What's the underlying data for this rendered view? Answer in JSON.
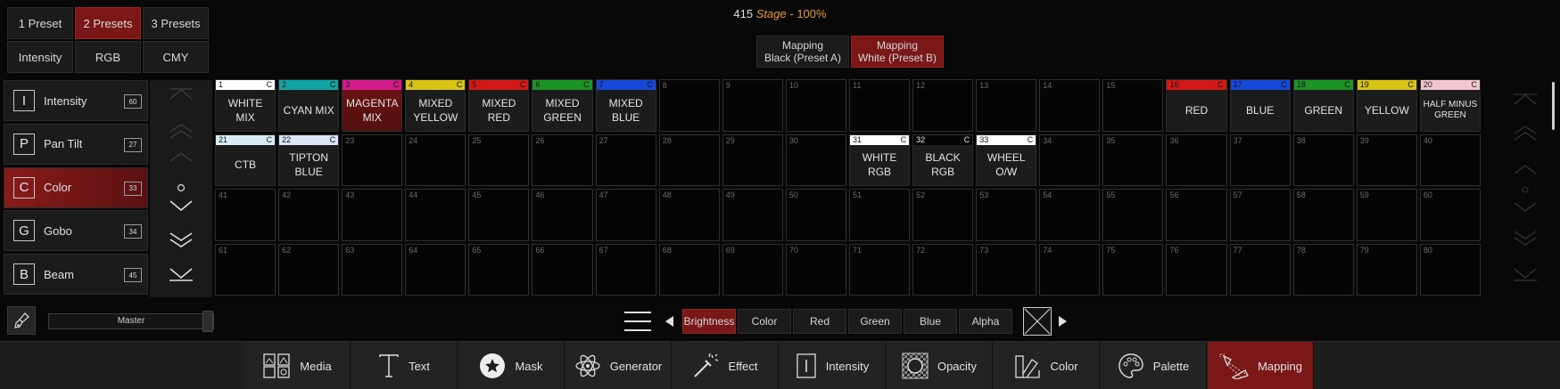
{
  "header": {
    "cue": "415",
    "stage": "Stage",
    "sep": "-",
    "percent": "100%"
  },
  "preset_tabs": [
    {
      "label": "1 Preset",
      "active": false
    },
    {
      "label": "2 Presets",
      "active": true
    },
    {
      "label": "3 Presets",
      "active": false
    },
    {
      "label": "Intensity",
      "active": false
    },
    {
      "label": "RGB",
      "active": false
    },
    {
      "label": "CMY",
      "active": false
    }
  ],
  "features": [
    {
      "letter": "I",
      "label": "Intensity",
      "count": "60",
      "active": false
    },
    {
      "letter": "P",
      "label": "Pan Tilt",
      "count": "27",
      "active": false
    },
    {
      "letter": "C",
      "label": "Color",
      "count": "33",
      "active": true
    },
    {
      "letter": "G",
      "label": "Gobo",
      "count": "34",
      "active": false
    },
    {
      "letter": "B",
      "label": "Beam",
      "count": "45",
      "active": false
    }
  ],
  "mapping_tabs": [
    {
      "line1": "Mapping",
      "line2": "Black (Preset A)",
      "active": false
    },
    {
      "line1": "Mapping",
      "line2": "White (Preset B)",
      "active": true
    }
  ],
  "palette": [
    {
      "n": "1",
      "name": "WHITE MIX",
      "color": "#ffffff",
      "c": "C"
    },
    {
      "n": "2",
      "name": "CYAN MIX",
      "color": "#12a3a3",
      "c": "C"
    },
    {
      "n": "3",
      "name": "MAGENTA MIX",
      "color": "#d21c8c",
      "c": "C",
      "sel": true
    },
    {
      "n": "4",
      "name": "MIXED YELLOW",
      "color": "#d8c414",
      "c": "C"
    },
    {
      "n": "5",
      "name": "MIXED RED",
      "color": "#d41818",
      "c": "C"
    },
    {
      "n": "6",
      "name": "MIXED GREEN",
      "color": "#1c9428",
      "c": "C"
    },
    {
      "n": "7",
      "name": "MIXED BLUE",
      "color": "#1848d8",
      "c": "C"
    },
    {
      "n": "8"
    },
    {
      "n": "9"
    },
    {
      "n": "10"
    },
    {
      "n": "11"
    },
    {
      "n": "12"
    },
    {
      "n": "13"
    },
    {
      "n": "14"
    },
    {
      "n": "15"
    },
    {
      "n": "16",
      "name": "RED",
      "color": "#d41818",
      "c": "C"
    },
    {
      "n": "17",
      "name": "BLUE",
      "color": "#1848d8",
      "c": "C"
    },
    {
      "n": "18",
      "name": "GREEN",
      "color": "#1c9428",
      "c": "C"
    },
    {
      "n": "19",
      "name": "YELLOW",
      "color": "#d8c414",
      "c": "C"
    },
    {
      "n": "20",
      "name": "HALF MINUS GREEN",
      "color": "#f2c6cc",
      "c": "C",
      "small": true
    },
    {
      "n": "21",
      "name": "CTB",
      "color": "#d8ecf4",
      "c": "C"
    },
    {
      "n": "22",
      "name": "TIPTON BLUE",
      "color": "#dde4f8",
      "c": "C"
    },
    {
      "n": "23"
    },
    {
      "n": "24"
    },
    {
      "n": "25"
    },
    {
      "n": "26"
    },
    {
      "n": "27"
    },
    {
      "n": "28"
    },
    {
      "n": "29"
    },
    {
      "n": "30"
    },
    {
      "n": "31",
      "name": "WHITE RGB",
      "color": "#ffffff",
      "c": "C"
    },
    {
      "n": "32",
      "name": "BLACK RGB",
      "color": "#050505",
      "c": "C",
      "darkbar": true
    },
    {
      "n": "33",
      "name": "WHEEL O/W",
      "color": "#ffffff",
      "c": "C"
    },
    {
      "n": "34"
    },
    {
      "n": "35"
    },
    {
      "n": "36"
    },
    {
      "n": "37"
    },
    {
      "n": "38"
    },
    {
      "n": "39"
    },
    {
      "n": "40"
    },
    {
      "n": "41"
    },
    {
      "n": "42"
    },
    {
      "n": "43"
    },
    {
      "n": "44"
    },
    {
      "n": "45"
    },
    {
      "n": "46"
    },
    {
      "n": "47"
    },
    {
      "n": "48"
    },
    {
      "n": "49"
    },
    {
      "n": "50"
    },
    {
      "n": "51"
    },
    {
      "n": "52"
    },
    {
      "n": "53"
    },
    {
      "n": "54"
    },
    {
      "n": "55"
    },
    {
      "n": "56"
    },
    {
      "n": "57"
    },
    {
      "n": "58"
    },
    {
      "n": "59"
    },
    {
      "n": "60"
    },
    {
      "n": "61"
    },
    {
      "n": "62"
    },
    {
      "n": "63"
    },
    {
      "n": "64"
    },
    {
      "n": "65"
    },
    {
      "n": "66"
    },
    {
      "n": "67"
    },
    {
      "n": "68"
    },
    {
      "n": "69"
    },
    {
      "n": "70"
    },
    {
      "n": "71"
    },
    {
      "n": "72"
    },
    {
      "n": "73"
    },
    {
      "n": "74"
    },
    {
      "n": "75"
    },
    {
      "n": "76"
    },
    {
      "n": "77"
    },
    {
      "n": "78"
    },
    {
      "n": "79"
    },
    {
      "n": "80"
    }
  ],
  "master": {
    "label": "Master"
  },
  "color_tabs": [
    {
      "label": "Brightness",
      "active": true
    },
    {
      "label": "Color",
      "active": false
    },
    {
      "label": "Red",
      "active": false
    },
    {
      "label": "Green",
      "active": false
    },
    {
      "label": "Blue",
      "active": false
    },
    {
      "label": "Alpha",
      "active": false
    }
  ],
  "toolbar": [
    {
      "label": "Media",
      "icon": "media-icon",
      "active": false
    },
    {
      "label": "Text",
      "icon": "text-icon",
      "active": false
    },
    {
      "label": "Mask",
      "icon": "mask-icon",
      "active": false
    },
    {
      "label": "Generator",
      "icon": "generator-icon",
      "active": false
    },
    {
      "label": "Effect",
      "icon": "effect-icon",
      "active": false
    },
    {
      "label": "Intensity",
      "icon": "intensity-icon",
      "active": false
    },
    {
      "label": "Opacity",
      "icon": "opacity-icon",
      "active": false
    },
    {
      "label": "Color",
      "icon": "color-icon",
      "active": false
    },
    {
      "label": "Palette",
      "icon": "palette-icon",
      "active": false
    },
    {
      "label": "Mapping",
      "icon": "mapping-icon",
      "active": true
    }
  ]
}
